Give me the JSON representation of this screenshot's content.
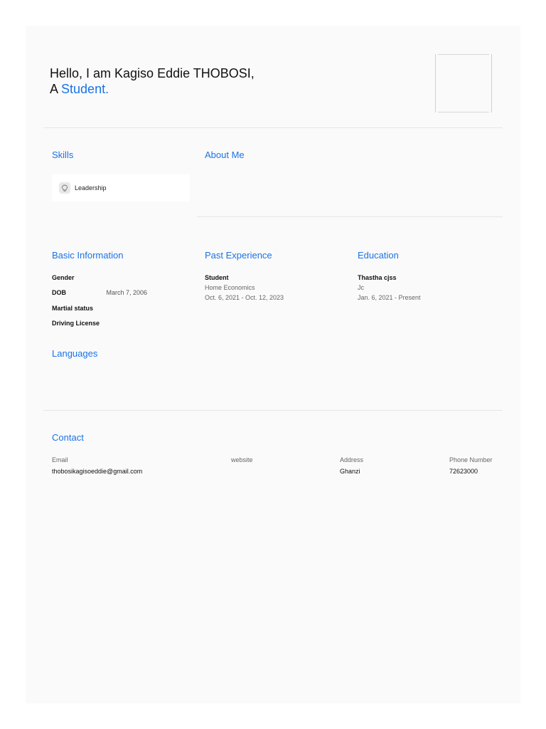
{
  "header": {
    "greeting": "Hello, I am Kagiso Eddie THOBOSI,",
    "role_prefix": "A",
    "role": "Student."
  },
  "skills": {
    "title": "Skills",
    "items": [
      {
        "label": "Leadership",
        "icon": "lightbulb-icon"
      }
    ]
  },
  "about": {
    "title": "About Me"
  },
  "basic_info": {
    "title": "Basic Information",
    "rows": [
      {
        "key": "Gender",
        "value": ""
      },
      {
        "key": "DOB",
        "value": "March 7, 2006"
      },
      {
        "key": "Martial status",
        "value": ""
      },
      {
        "key": "Driving License",
        "value": ""
      }
    ]
  },
  "experience": {
    "title": "Past Experience",
    "items": [
      {
        "role": "Student",
        "field": "Home Economics",
        "dates": "Oct. 6, 2021 - Oct. 12, 2023"
      }
    ]
  },
  "education": {
    "title": "Education",
    "items": [
      {
        "school": "Thastha cjss",
        "level": "Jc",
        "dates": "Jan. 6, 2021 - Present"
      }
    ]
  },
  "languages": {
    "title": "Languages"
  },
  "contact": {
    "title": "Contact",
    "email_label": "Email",
    "email": "thobosikagisoeddie@gmail.com",
    "website_label": "website",
    "website": "",
    "address_label": "Address",
    "address": "Ghanzi",
    "phone_label": "Phone Number",
    "phone": "72623000"
  },
  "colors": {
    "accent": "#1a73e8",
    "page_bg": "#fafafa"
  }
}
